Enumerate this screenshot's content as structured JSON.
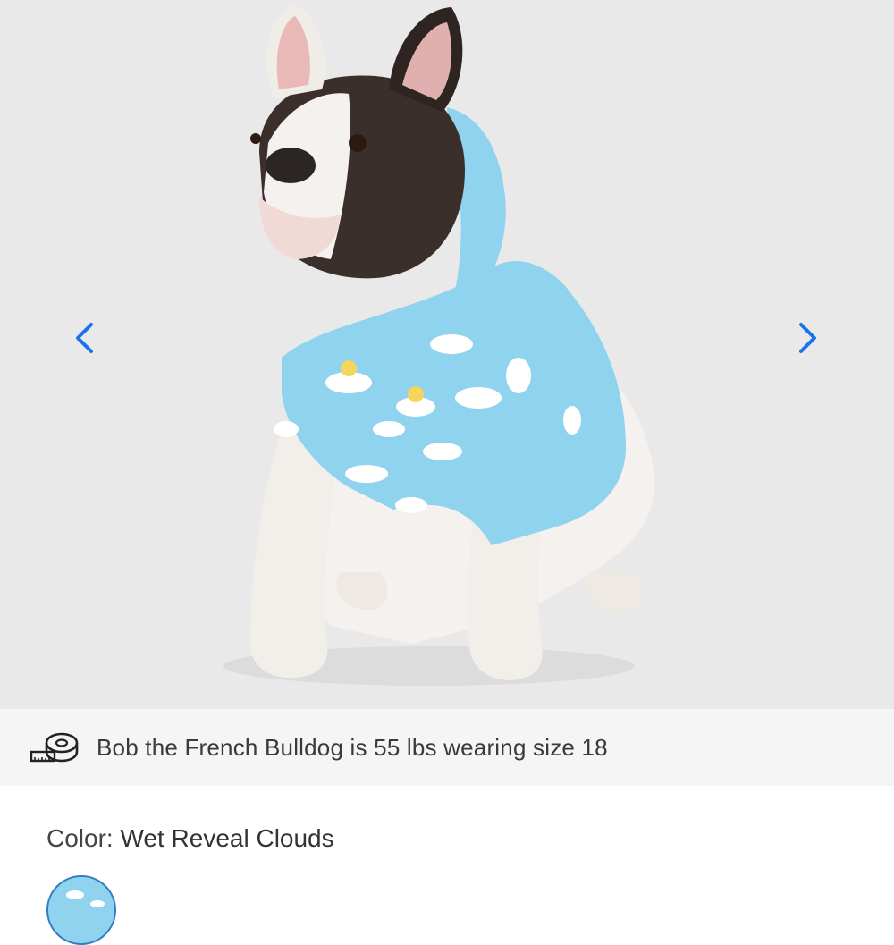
{
  "gallery": {
    "prev_icon": "chevron-left-icon",
    "next_icon": "chevron-right-icon",
    "image_subject": "dog-in-cloud-print-jacket"
  },
  "size_info": {
    "icon": "measuring-tape-icon",
    "text": "Bob the French Bulldog is 55 lbs wearing size 18"
  },
  "color": {
    "label": "Color:",
    "value": "Wet Reveal Clouds"
  },
  "colors": {
    "accent": "#1a73e8",
    "gallery_bg": "#e9e9ea",
    "info_bg": "#f5f5f5",
    "jacket": "#8fd3ee"
  }
}
